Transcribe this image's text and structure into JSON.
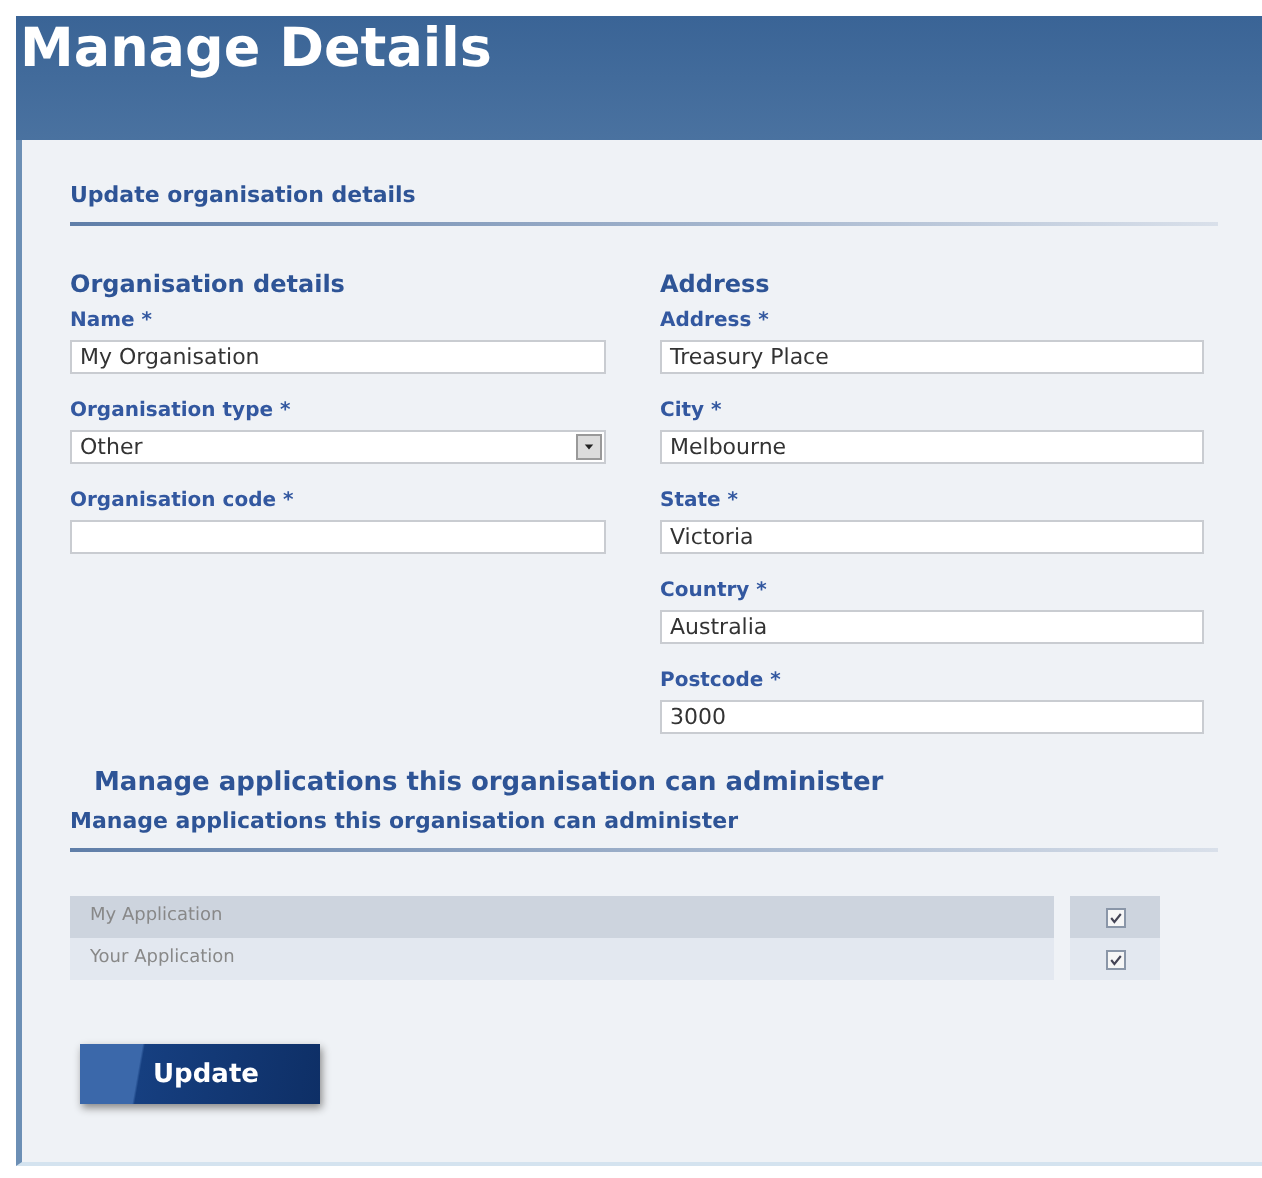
{
  "page_title": "Manage Details",
  "section_title": "Update organisation details",
  "columns": [
    {
      "heading": "Organisation details",
      "fields": [
        {
          "label": "Name *",
          "kind": "text",
          "value": "My Organisation"
        },
        {
          "label": "Organisation type *",
          "kind": "select",
          "value": "Other"
        },
        {
          "label": "Organisation code *",
          "kind": "text"
        }
      ]
    },
    {
      "heading": "Address",
      "fields": [
        {
          "label": "Address *",
          "kind": "text",
          "value": "Treasury Place"
        },
        {
          "label": "City *",
          "kind": "text",
          "value": "Melbourne"
        },
        {
          "label": "State *",
          "kind": "text",
          "value": "Victoria"
        },
        {
          "label": "Country *",
          "kind": "text",
          "value": "Australia"
        },
        {
          "label": "Postcode *",
          "kind": "text",
          "value": "3000"
        }
      ]
    }
  ],
  "applications_heading": "Manage applications this organisation can administer",
  "applications_title": "Manage applications this organisation can administer",
  "applications": [
    {
      "name": "My Application",
      "selected": true,
      "checked": true
    },
    {
      "name": "Your Application",
      "selected": false,
      "checked": true
    }
  ],
  "update_button": "Update"
}
